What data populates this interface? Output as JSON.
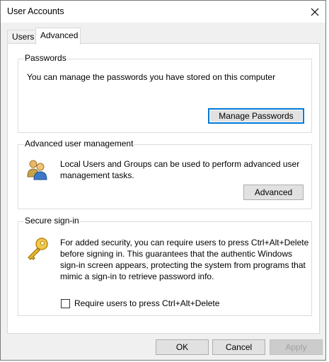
{
  "window": {
    "title": "User Accounts"
  },
  "tabs": [
    {
      "label": "Users"
    },
    {
      "label": "Advanced"
    }
  ],
  "passwords": {
    "legend": "Passwords",
    "text": "You can manage the passwords you have stored on this computer",
    "button": "Manage Passwords"
  },
  "advanced_mgmt": {
    "legend": "Advanced user management",
    "text": "Local Users and Groups can be used to perform advanced user management tasks.",
    "button": "Advanced"
  },
  "secure": {
    "legend": "Secure sign-in",
    "text": "For added security, you can require users to press Ctrl+Alt+Delete before signing in. This guarantees that the authentic Windows sign-in screen appears, protecting the system from programs that mimic a sign-in to retrieve password info.",
    "checkbox_label": "Require users to press Ctrl+Alt+Delete",
    "checkbox_checked": false
  },
  "footer": {
    "ok": "OK",
    "cancel": "Cancel",
    "apply": "Apply"
  },
  "colors": {
    "accent": "#0078d7",
    "dialog_bg": "#f0f0f0"
  },
  "icons": {
    "close": "close-icon",
    "users": "users-group-icon",
    "key": "key-icon"
  }
}
